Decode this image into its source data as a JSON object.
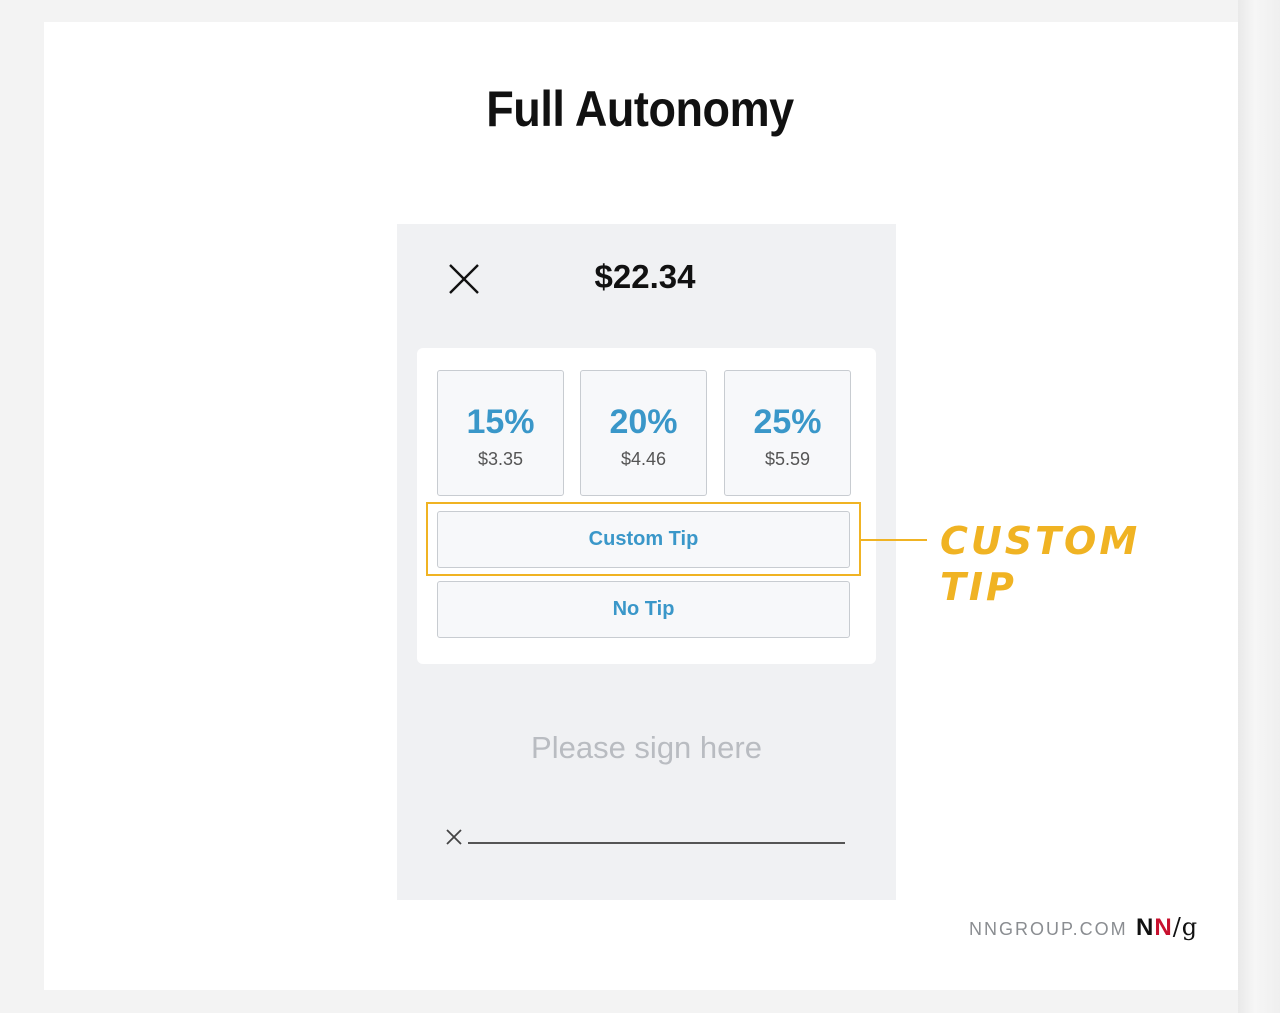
{
  "title": "Full Autonomy",
  "payment": {
    "amount": "$22.34",
    "close_icon": "close-icon"
  },
  "tip_options": [
    {
      "percent": "15%",
      "amount": "$3.35"
    },
    {
      "percent": "20%",
      "amount": "$4.46"
    },
    {
      "percent": "25%",
      "amount": "$5.59"
    }
  ],
  "custom_tip_label": "Custom Tip",
  "no_tip_label": "No Tip",
  "annotation": {
    "text": "CUSTOM\nTIP",
    "color": "#f0b323"
  },
  "signature": {
    "placeholder": "Please sign here",
    "marker_icon": "x-icon"
  },
  "footer": {
    "domain": "NNGROUP.COM",
    "logo": {
      "n1": "N",
      "n2": "N",
      "slash": "/",
      "g": "g"
    }
  },
  "colors": {
    "accent": "#3a97c9",
    "highlight": "#f0b323",
    "logo_red": "#c8102e"
  }
}
